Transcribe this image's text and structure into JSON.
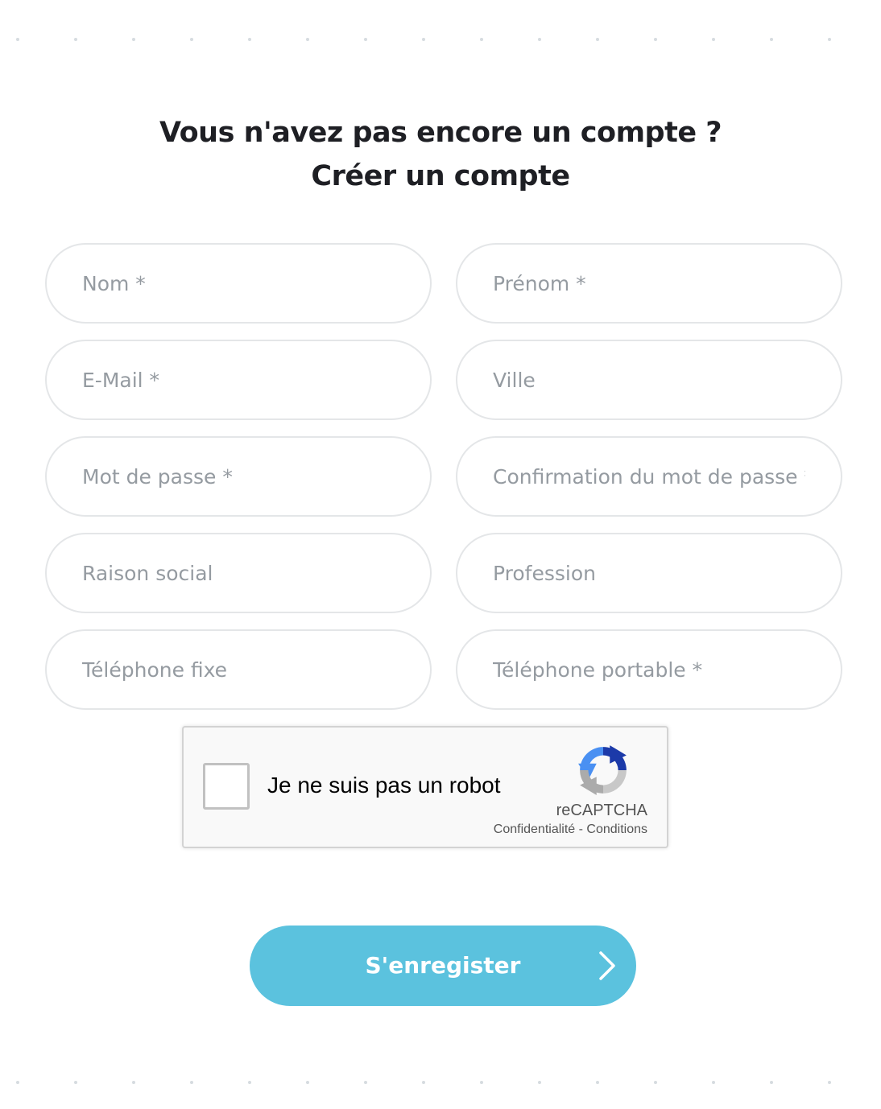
{
  "heading": {
    "line1": "Vous n'avez pas encore un compte ?",
    "line2": "Créer un compte"
  },
  "form": {
    "nom_placeholder": "Nom *",
    "prenom_placeholder": "Prénom *",
    "email_placeholder": "E-Mail *",
    "ville_placeholder": "Ville",
    "password_placeholder": "Mot de passe *",
    "password_confirm_placeholder": "Confirmation du mot de passe *",
    "raison_social_placeholder": "Raison social",
    "profession_placeholder": "Profession",
    "phone_fixed_placeholder": "Téléphone fixe",
    "phone_mobile_placeholder": "Téléphone portable *"
  },
  "recaptcha": {
    "label": "Je ne suis pas un robot",
    "brand": "reCAPTCHA",
    "privacy": "Confidentialité",
    "separator": " - ",
    "terms": "Conditions"
  },
  "submit": {
    "label": "S'enregister",
    "icon": "chevron-right-icon"
  },
  "colors": {
    "accent": "#5bc2de",
    "heading": "#1e1f24",
    "placeholder": "#959ba1",
    "field_border": "#e4e6e8"
  }
}
